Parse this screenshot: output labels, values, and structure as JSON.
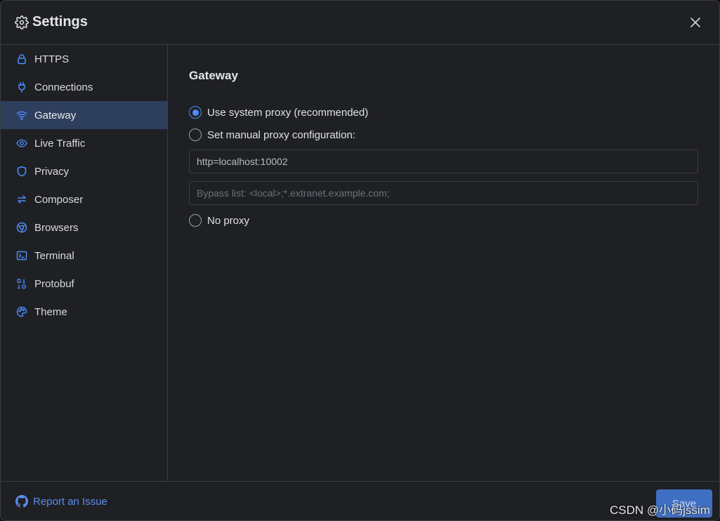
{
  "window": {
    "title": "Settings",
    "title_icon": "gear-icon",
    "close_icon": "close-icon"
  },
  "sidebar": {
    "items": [
      {
        "label": "HTTPS",
        "icon": "lock-icon",
        "active": false
      },
      {
        "label": "Connections",
        "icon": "plug-icon",
        "active": false
      },
      {
        "label": "Gateway",
        "icon": "wifi-icon",
        "active": true
      },
      {
        "label": "Live Traffic",
        "icon": "eye-icon",
        "active": false
      },
      {
        "label": "Privacy",
        "icon": "shield-icon",
        "active": false
      },
      {
        "label": "Composer",
        "icon": "arrows-exchange-icon",
        "active": false
      },
      {
        "label": "Browsers",
        "icon": "chrome-icon",
        "active": false
      },
      {
        "label": "Terminal",
        "icon": "terminal-icon",
        "active": false
      },
      {
        "label": "Protobuf",
        "icon": "binary-icon",
        "active": false
      },
      {
        "label": "Theme",
        "icon": "palette-icon",
        "active": false
      }
    ]
  },
  "gateway": {
    "title": "Gateway",
    "options": {
      "system": "Use system proxy (recommended)",
      "manual": "Set manual proxy configuration:",
      "none": "No proxy"
    },
    "selected": "system",
    "proxy_value": "http=localhost:10002",
    "bypass_placeholder": "Bypass list: <local>;*.extranet.example.com;"
  },
  "footer": {
    "report_label": "Report an Issue",
    "report_icon": "github-icon",
    "save_label": "Save"
  },
  "watermark": "CSDN @小码jssim",
  "colors": {
    "accent": "#4c8dff",
    "active_bg": "#2e3f5e",
    "link": "#5b8def",
    "save_bg": "#3f6fc2",
    "background": "#1f2024"
  }
}
